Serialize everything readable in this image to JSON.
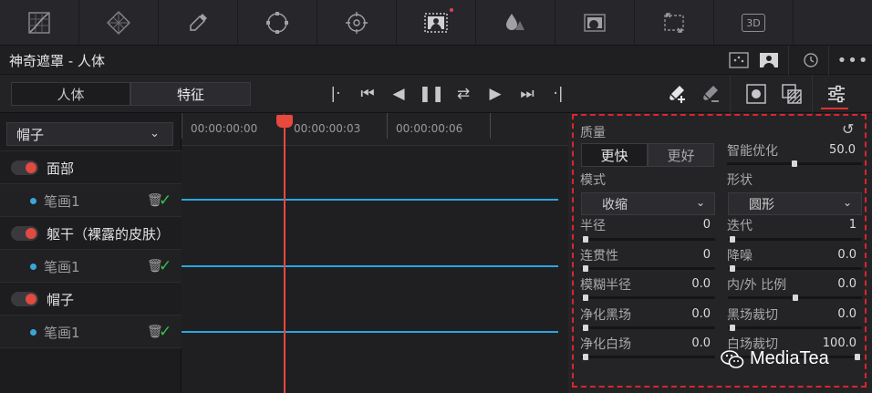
{
  "toolbar": {
    "icons": [
      "curves-grid-icon",
      "color-warper-mesh-icon",
      "qualifier-eyedropper-icon",
      "power-window-icon",
      "tracker-icon",
      "magic-mask-icon",
      "blur-drops-icon",
      "key-icon",
      "sizing-icon",
      "3d-icon"
    ],
    "label_3d": "3D"
  },
  "titlebar": {
    "title": "神奇遮罩 - 人体"
  },
  "modes": {
    "person": "人体",
    "feature": "特征"
  },
  "left": {
    "dropdown_value": "帽子",
    "rows": [
      {
        "type": "group",
        "label": "面部"
      },
      {
        "type": "stroke",
        "label": "笔画1"
      },
      {
        "type": "group",
        "label": "躯干（裸露的皮肤）"
      },
      {
        "type": "stroke",
        "label": "笔画1"
      },
      {
        "type": "group",
        "label": "帽子"
      },
      {
        "type": "stroke",
        "label": "笔画1"
      }
    ]
  },
  "timeline": {
    "timecodes": [
      "00:00:00:00",
      "00:00:00:03",
      "00:00:00:06"
    ]
  },
  "panel": {
    "quality_label": "质量",
    "quality_options": [
      "更快",
      "更好"
    ],
    "smart_refine_label": "智能优化",
    "smart_refine_value": "50.0",
    "mode_label": "模式",
    "mode_value": "收缩",
    "shape_label": "形状",
    "shape_value": "圆形",
    "radius_label": "半径",
    "radius_value": "0",
    "iterations_label": "迭代",
    "iterations_value": "1",
    "consistency_label": "连贯性",
    "consistency_value": "0",
    "denoise_label": "降噪",
    "denoise_value": "0.0",
    "blur_radius_label": "模糊半径",
    "blur_radius_value": "0.0",
    "in_out_ratio_label": "内/外 比例",
    "in_out_ratio_value": "0.0",
    "clean_black_label": "净化黑场",
    "clean_black_value": "0.0",
    "black_clip_label": "黑场裁切",
    "black_clip_value": "0.0",
    "clean_white_label": "净化白场",
    "clean_white_value": "0.0",
    "white_clip_label": "白场裁切",
    "white_clip_value": "100.0"
  },
  "watermark": {
    "text": "MediaTea"
  },
  "colors": {
    "accent_red": "#e8493c",
    "track_blue": "#2aa7e0",
    "check_green": "#37c24a",
    "highlight_frame": "#d8262c"
  }
}
